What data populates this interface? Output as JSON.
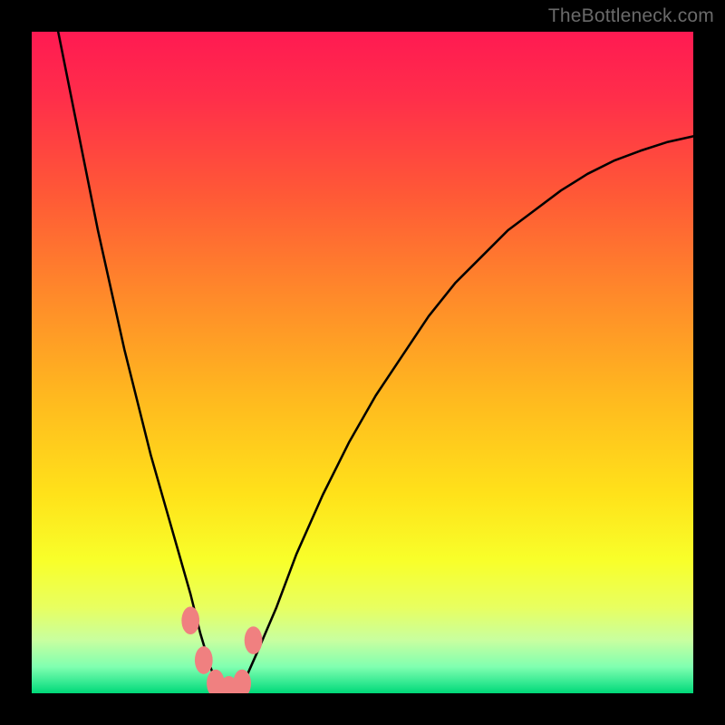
{
  "watermark": "TheBottleneck.com",
  "chart_data": {
    "type": "line",
    "title": "",
    "xlabel": "",
    "ylabel": "",
    "xlim": [
      0,
      100
    ],
    "ylim": [
      0,
      100
    ],
    "grid": false,
    "legend": false,
    "series": [
      {
        "name": "bottleneck-curve",
        "x": [
          4,
          6,
          8,
          10,
          12,
          14,
          16,
          18,
          20,
          22,
          24,
          25.5,
          27,
          28,
          29,
          30,
          32,
          34,
          37,
          40,
          44,
          48,
          52,
          56,
          60,
          64,
          68,
          72,
          76,
          80,
          84,
          88,
          92,
          96,
          100
        ],
        "values": [
          100,
          90,
          80,
          70,
          61,
          52,
          44,
          36,
          29,
          22,
          15,
          9,
          4,
          1.5,
          0.4,
          0.1,
          1.5,
          6,
          13,
          21,
          30,
          38,
          45,
          51,
          57,
          62,
          66,
          70,
          73,
          76,
          78.5,
          80.5,
          82,
          83.3,
          84.2
        ]
      }
    ],
    "markers": {
      "name": "highlight-dots",
      "color": "#f08080",
      "points": [
        {
          "x": 24.0,
          "y": 11
        },
        {
          "x": 26.0,
          "y": 5
        },
        {
          "x": 27.8,
          "y": 1.5
        },
        {
          "x": 29.8,
          "y": 0.5
        },
        {
          "x": 31.8,
          "y": 1.5
        },
        {
          "x": 33.5,
          "y": 8
        }
      ]
    },
    "gradient_stops": [
      {
        "offset": 0.0,
        "color": "#ff1a52"
      },
      {
        "offset": 0.1,
        "color": "#ff2e4a"
      },
      {
        "offset": 0.25,
        "color": "#ff5a36"
      },
      {
        "offset": 0.4,
        "color": "#ff8a2a"
      },
      {
        "offset": 0.55,
        "color": "#ffb81f"
      },
      {
        "offset": 0.7,
        "color": "#ffe21a"
      },
      {
        "offset": 0.8,
        "color": "#f8ff2a"
      },
      {
        "offset": 0.87,
        "color": "#e8ff60"
      },
      {
        "offset": 0.92,
        "color": "#c8ffa0"
      },
      {
        "offset": 0.96,
        "color": "#80ffb0"
      },
      {
        "offset": 0.985,
        "color": "#30e890"
      },
      {
        "offset": 1.0,
        "color": "#00d878"
      }
    ]
  }
}
